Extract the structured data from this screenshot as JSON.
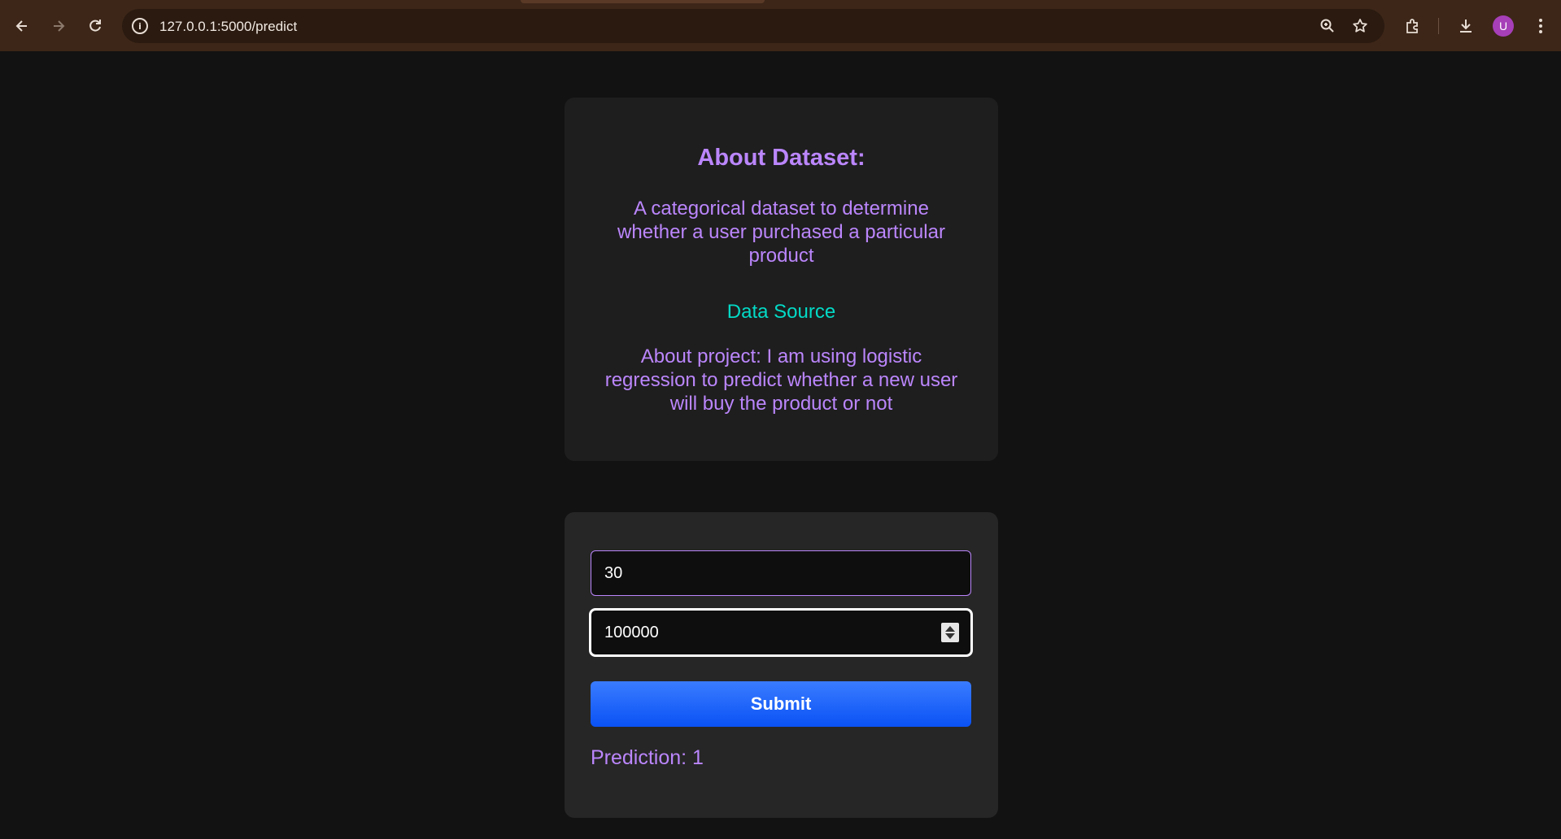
{
  "browser": {
    "url": "127.0.0.1:5000/predict",
    "profile_initial": "U"
  },
  "about": {
    "title": "About Dataset:",
    "description": "A categorical dataset to determine whether a user purchased a particular product",
    "source_link": "Data Source",
    "project": "About project: I am using logistic regression to predict whether a new user will buy the product or not"
  },
  "form": {
    "age_value": "30",
    "salary_value": "100000",
    "submit_label": "Submit",
    "prediction_text": "Prediction: 1"
  },
  "colors": {
    "background": "#121212",
    "card": "#1e1e1e",
    "accent_purple": "#bb86fc",
    "link_teal": "#03dac6",
    "button_blue": "#0a52f5"
  }
}
